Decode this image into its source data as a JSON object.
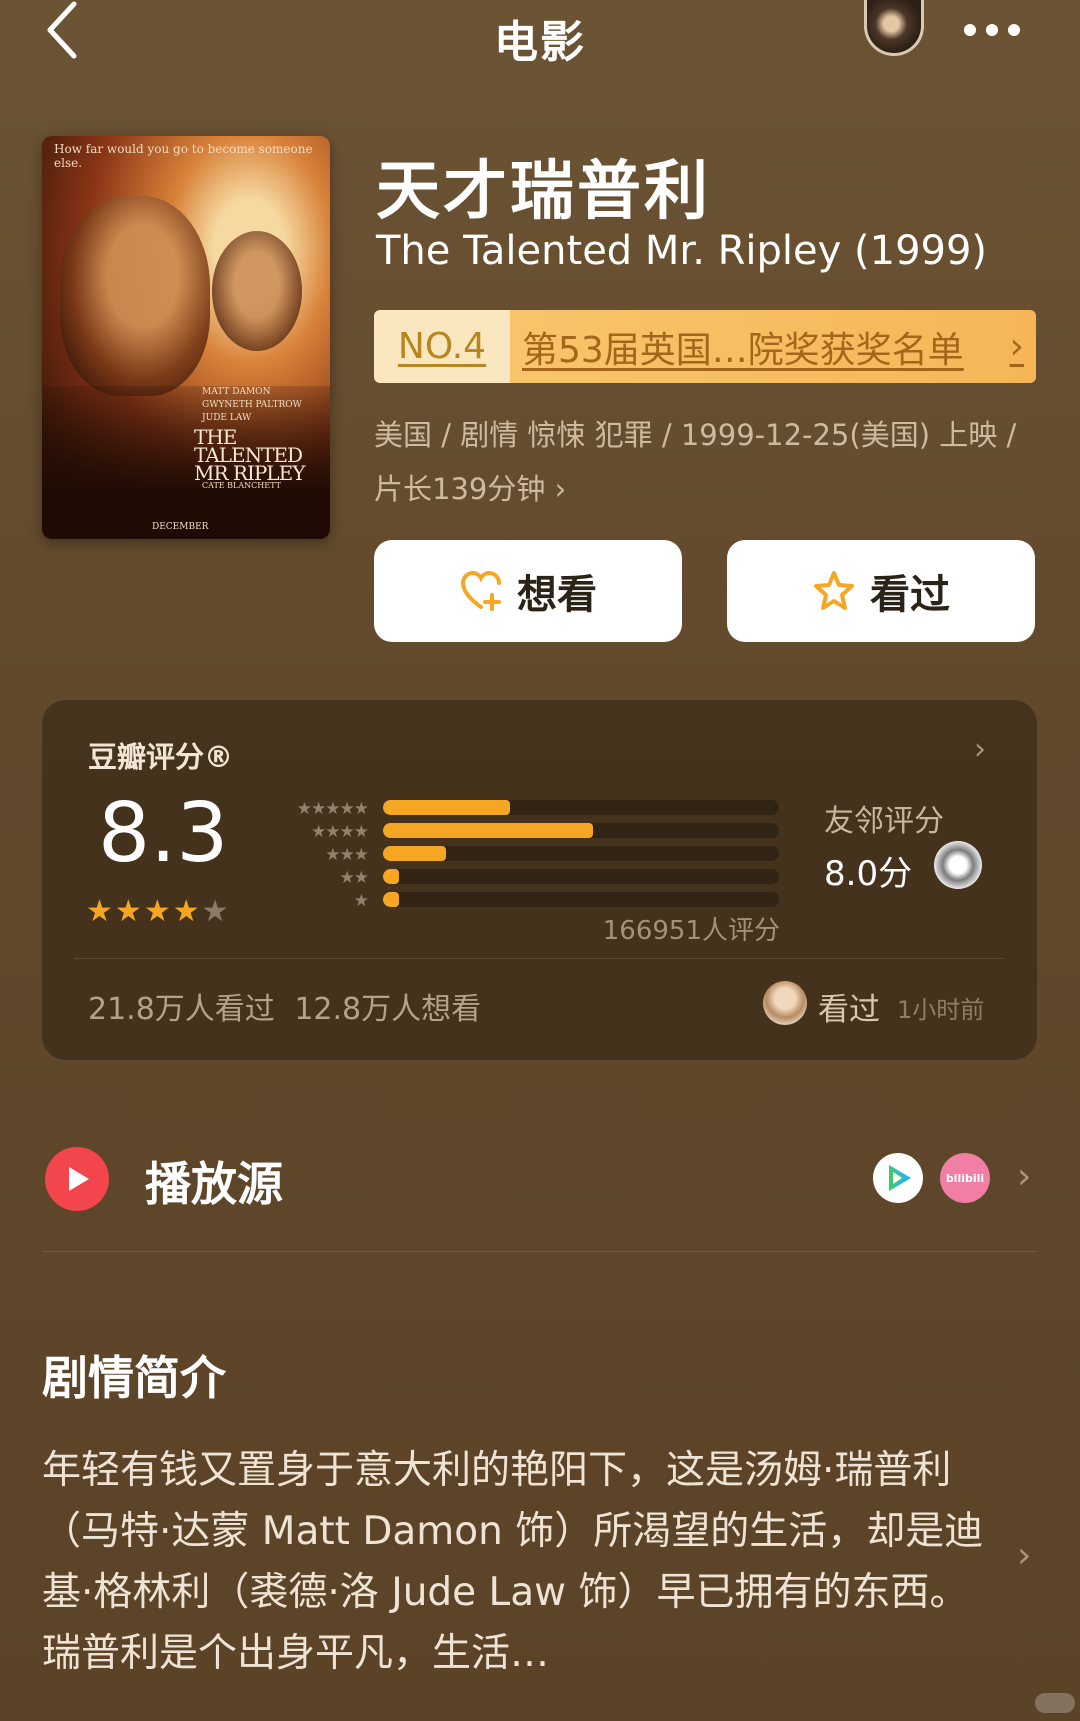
{
  "header": {
    "title": "电影"
  },
  "poster": {
    "tagline": "How far would you go to become someone else.",
    "cast": [
      "MATT DAMON",
      "GWYNETH PALTROW",
      "JUDE LAW"
    ],
    "title_lines": [
      "THE",
      "TALENTED",
      "MR RIPLEY"
    ],
    "extra_cast": "CATE BLANCHETT",
    "month": "DECEMBER"
  },
  "movie": {
    "title_cn": "天才瑞普利",
    "title_en": "The Talented Mr. Ripley (1999)",
    "rank": {
      "number": "NO.4",
      "list": "第53届英国…院奖获奖名单"
    },
    "meta": "美国 / 剧情 惊悚 犯罪 / 1999-12-25(美国) 上映 / 片长139分钟 ›"
  },
  "actions": {
    "want": "想看",
    "seen": "看过"
  },
  "rating": {
    "label": "豆瓣评分®",
    "score": "8.3",
    "stars": 4,
    "distribution": [
      0.32,
      0.53,
      0.16,
      0.04,
      0.04
    ],
    "votes": "166951人评分",
    "friend_label": "友邻评分",
    "friend_score": "8.0分",
    "stats": "21.8万人看过 12.8万人想看",
    "seen_label": "看过",
    "seen_time": "1小时前"
  },
  "play": {
    "title": "播放源",
    "sources": [
      "tencent-video",
      "bilibili"
    ],
    "bili_text": "bilibili"
  },
  "synopsis": {
    "title": "剧情简介",
    "body": "年轻有钱又置身于意大利的艳阳下，这是汤姆·瑞普利（马特·达蒙 Matt Damon 饰）所渴望的生活，却是迪基·格林利（裘德·洛 Jude Law 饰）早已拥有的东西。瑞普利是个出身平凡，生活…"
  },
  "colors": {
    "accent": "#f5a623",
    "play_red": "#f2464c",
    "rank_bg": "#f6b657"
  }
}
